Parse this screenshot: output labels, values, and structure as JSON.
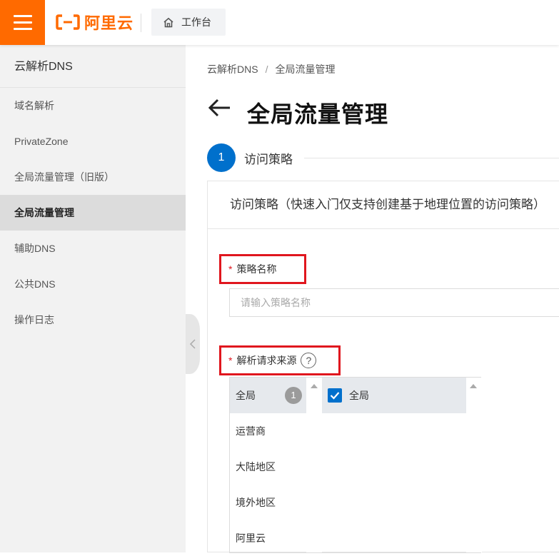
{
  "topbar": {
    "brand_text": "阿里云",
    "workbench_label": "工作台",
    "brand_color": "#ff6a00"
  },
  "sidebar": {
    "title": "云解析DNS",
    "items": [
      {
        "label": "域名解析"
      },
      {
        "label": "PrivateZone"
      },
      {
        "label": "全局流量管理（旧版）"
      },
      {
        "label": "全局流量管理",
        "active": true
      },
      {
        "label": "辅助DNS"
      },
      {
        "label": "公共DNS"
      },
      {
        "label": "操作日志"
      }
    ]
  },
  "breadcrumb": {
    "root": "云解析DNS",
    "separator": "/",
    "current": "全局流量管理"
  },
  "page": {
    "title": "全局流量管理"
  },
  "step": {
    "number": "1",
    "label": "访问策略",
    "color": "#0070cc"
  },
  "panel": {
    "heading": "访问策略（快速入门仅支持创建基于地理位置的访问策略）"
  },
  "form": {
    "required_mark": "*",
    "policy_name_label": "策略名称",
    "policy_name_placeholder": "请输入策略名称",
    "source_label": "解析请求来源",
    "help_glyph": "?"
  },
  "source_categories": [
    {
      "label": "全局",
      "count": "1",
      "selected": true
    },
    {
      "label": "运营商"
    },
    {
      "label": "大陆地区"
    },
    {
      "label": "境外地区"
    },
    {
      "label": "阿里云"
    }
  ],
  "source_options": [
    {
      "label": "全局",
      "checked": true
    }
  ],
  "highlight_color": "#e0161e"
}
